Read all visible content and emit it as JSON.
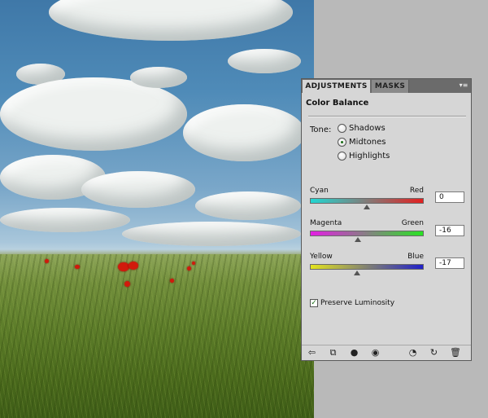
{
  "colors": {
    "panel_bg": "#d6d6d6",
    "tab_bar": "#6b6b6b",
    "cyan": "#22d7d2",
    "red": "#e32020",
    "magenta": "#e31ee3",
    "green": "#29e323",
    "yellow": "#e3e31e",
    "blue": "#2020c8"
  },
  "panel": {
    "tabs": [
      {
        "label": "ADJUSTMENTS",
        "active": true
      },
      {
        "label": "MASKS",
        "active": false
      }
    ],
    "menu_icon": "panel-menu-icon",
    "title": "Color Balance",
    "tone": {
      "label": "Tone:",
      "options": [
        "Shadows",
        "Midtones",
        "Highlights"
      ],
      "selected": "Midtones"
    },
    "sliders": [
      {
        "left": "Cyan",
        "right": "Red",
        "value": "0",
        "position": 0.5
      },
      {
        "left": "Magenta",
        "right": "Green",
        "value": "-16",
        "position": 0.42
      },
      {
        "left": "Yellow",
        "right": "Blue",
        "value": "-17",
        "position": 0.415
      }
    ],
    "preserve_luminosity": {
      "label": "Preserve Luminosity",
      "checked": true
    },
    "bottom_icons": [
      "back-arrow-icon",
      "clip-to-layer-icon",
      "layer-visibility-icon",
      "eye-icon",
      "view-previous-icon",
      "reset-icon",
      "trash-icon"
    ]
  }
}
